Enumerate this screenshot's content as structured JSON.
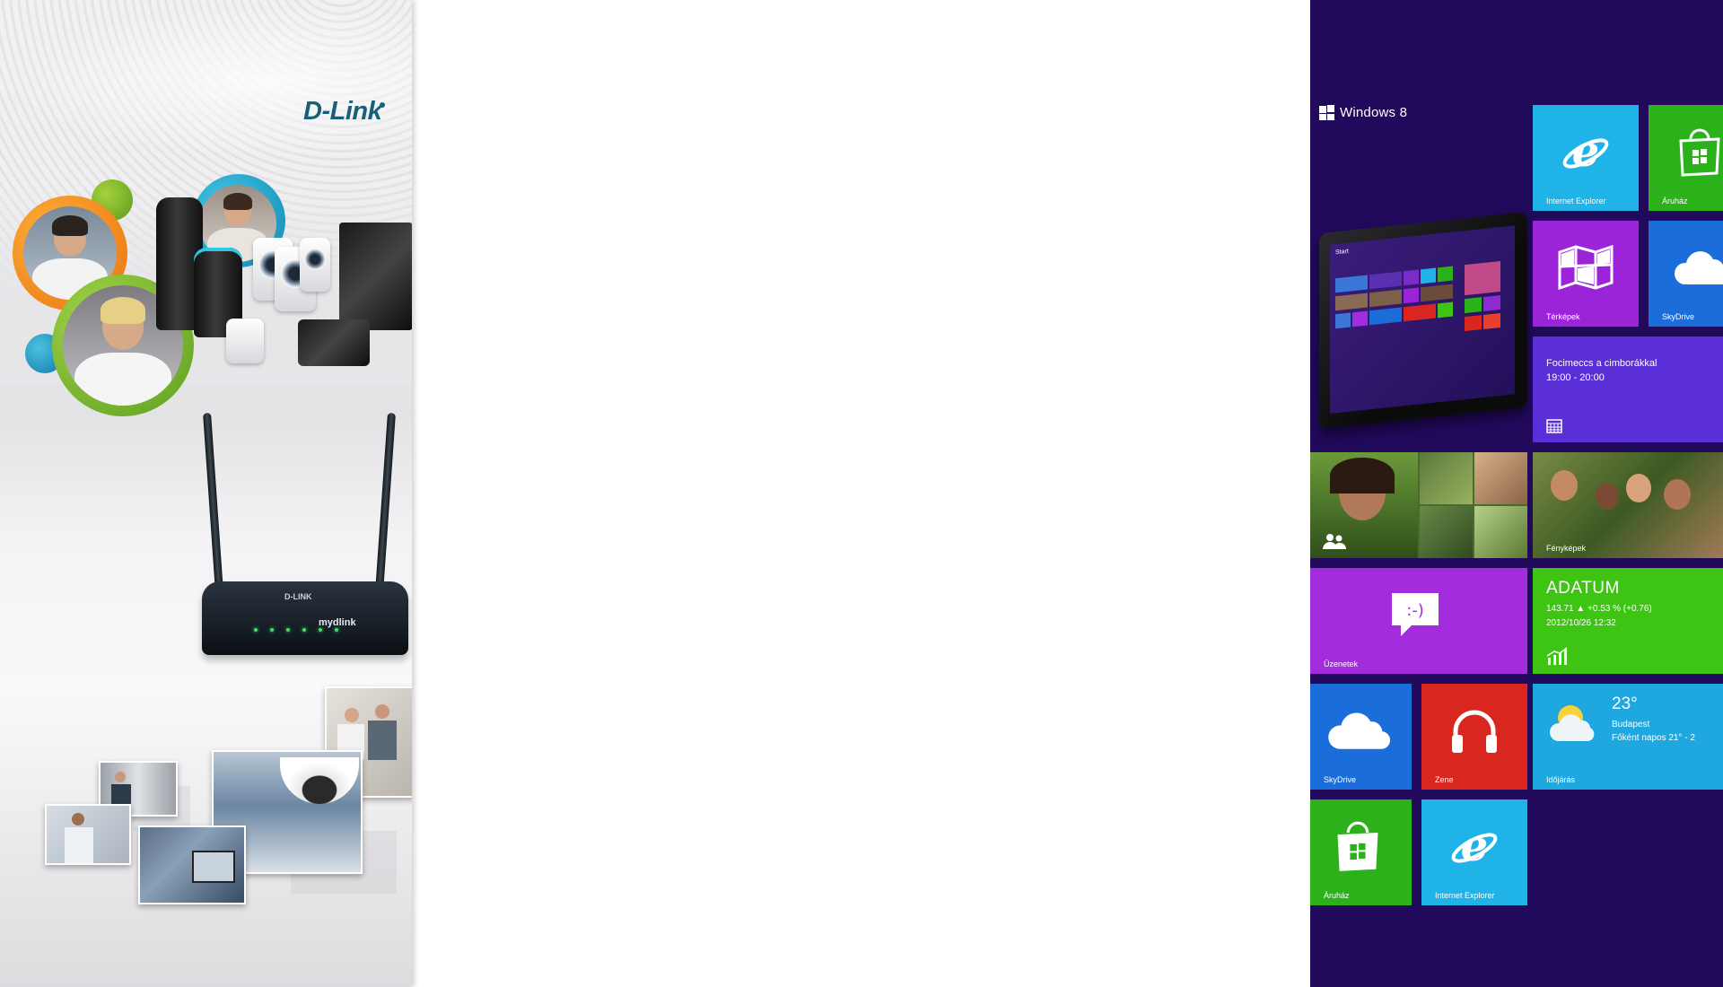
{
  "left_panel": {
    "brand_logo": "D-Link",
    "router": {
      "brand": "D-LINK",
      "product_label": "mydlink"
    }
  },
  "right_panel": {
    "os_title": "Windows 8",
    "tablet": {
      "screen_title": "Start"
    },
    "tiles": {
      "ie_top": "Internet Explorer",
      "store_top": "Áruház",
      "maps": "Térképek",
      "skydrive_top": "SkyDrive",
      "calendar_event": "Focimeccs a cimborákkal",
      "calendar_time": "19:00 - 20:00",
      "photos": "Fényképek",
      "messaging": "Üzenetek",
      "finance_name": "ADATUM",
      "finance_quote": "143.71 ▲ +0.53 % (+0.76)",
      "finance_date": "2012/10/26 12:32",
      "skydrive_bottom": "SkyDrive",
      "music": "Zene",
      "weather_temp": "23°",
      "weather_city": "Budapest",
      "weather_desc": "Főként napos 21° - 2",
      "weather": "Időjárás",
      "store_bottom": "Áruház",
      "ie_bottom": "Internet Explorer"
    },
    "colors": {
      "background": "#21095c",
      "ie": "#1fb3e8",
      "store": "#2bb21b",
      "maps": "#9b24d9",
      "skydrive": "#1b6dd9",
      "calendar": "#5b2fd8",
      "messaging": "#a32ddc",
      "finance": "#3ec412",
      "music": "#d9261e",
      "weather": "#1fa7e0"
    }
  }
}
